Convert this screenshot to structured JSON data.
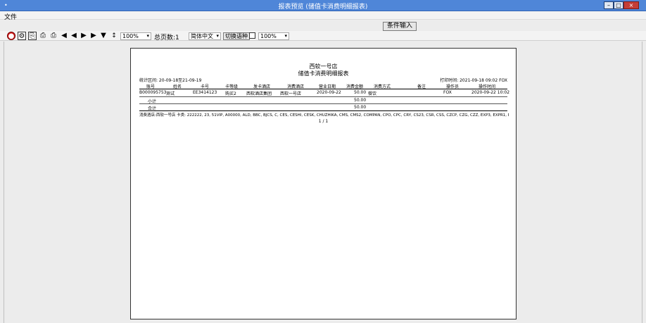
{
  "window": {
    "app_icon": "•",
    "title": "报表预览 (储值卡消费明细报表)"
  },
  "menu": {
    "file": "文件"
  },
  "condition_button": "条件输入",
  "toolbar": {
    "zoom1": "100%",
    "total_pages": "总页数:1",
    "language": "简体中文",
    "switch_lang": "切换语种",
    "zoom2": "100%"
  },
  "report": {
    "store": "西软一号店",
    "title": "储值卡消费明细报表",
    "range": "统计区间:   20-09-18至21-09-19",
    "print_time": "打印时间: 2021-09-18 09:02 FOX",
    "columns": [
      "账号",
      "姓名",
      "卡号",
      "卡等级",
      "发卡酒店",
      "消费酒店",
      "营业日期",
      "消费金额",
      "消费方式",
      "备注",
      "操作员",
      "操作时间"
    ],
    "rows": [
      [
        "B000095753",
        "测试",
        "EE3414123",
        "购买2",
        "西软酒店集团",
        "西软一号店",
        "2020-09-22",
        "50.00",
        "餐饮",
        "",
        "FOX",
        "2020-09-22 10:02"
      ]
    ],
    "subtotal_label": "小计",
    "subtotal_value": "50.00",
    "total_label": "合计",
    "total_value": "50.00",
    "filter_line": "消费酒店:西软一号店   卡类: 222222, 23, 51VIP, A00000, ALD, BBC, BJCS, C, CES, CESHI, CESK, CHUZHIKA, CMS, CMS2, COMPAN, CPO, CPC, CRY, CS23, CSR, CSS, CZCP, CZG, CZZ, EXP3, EXPR1, EXPRE2, EXPRE3, FFK, FFTEST, I",
    "pager": "1 / 1"
  }
}
